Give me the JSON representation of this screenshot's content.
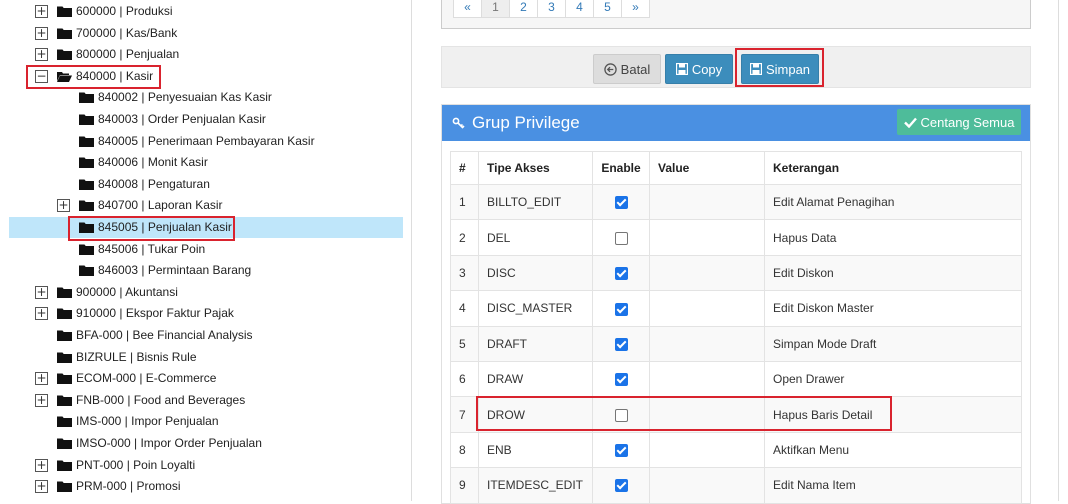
{
  "tree": {
    "nodes": [
      {
        "label": "600000 | Produksi",
        "toggle": "+",
        "open": false
      },
      {
        "label": "700000 | Kas/Bank",
        "toggle": "+",
        "open": false
      },
      {
        "label": "800000 | Penjualan",
        "toggle": "+",
        "open": false
      },
      {
        "label": "840000 | Kasir",
        "toggle": "−",
        "open": true
      },
      {
        "label": "840002 | Penyesuaian Kas Kasir",
        "toggle": "",
        "open": false
      },
      {
        "label": "840003 | Order Penjualan Kasir",
        "toggle": "",
        "open": false
      },
      {
        "label": "840005 | Penerimaan Pembayaran Kasir",
        "toggle": "",
        "open": false
      },
      {
        "label": "840006 | Monit Kasir",
        "toggle": "",
        "open": false
      },
      {
        "label": "840008 | Pengaturan",
        "toggle": "",
        "open": false
      },
      {
        "label": "840700 | Laporan Kasir",
        "toggle": "+",
        "open": false
      },
      {
        "label": "845005 | Penjualan Kasir",
        "toggle": "",
        "open": false,
        "selected": true
      },
      {
        "label": "845006 | Tukar Poin",
        "toggle": "",
        "open": false
      },
      {
        "label": "846003 | Permintaan Barang",
        "toggle": "",
        "open": false
      },
      {
        "label": "900000 | Akuntansi",
        "toggle": "+",
        "open": false
      },
      {
        "label": "910000 | Ekspor Faktur Pajak",
        "toggle": "+",
        "open": false
      },
      {
        "label": "BFA-000 | Bee Financial Analysis",
        "toggle": "",
        "open": false
      },
      {
        "label": "BIZRULE | Bisnis Rule",
        "toggle": "",
        "open": false
      },
      {
        "label": "ECOM-000 | E-Commerce",
        "toggle": "+",
        "open": false
      },
      {
        "label": "FNB-000 | Food and Beverages",
        "toggle": "+",
        "open": false
      },
      {
        "label": "IMS-000 | Impor Penjualan",
        "toggle": "",
        "open": false
      },
      {
        "label": "IMSO-000 | Impor Order Penjualan",
        "toggle": "",
        "open": false
      },
      {
        "label": "PNT-000 | Poin Loyalti",
        "toggle": "+",
        "open": false
      },
      {
        "label": "PRM-000 | Promosi",
        "toggle": "+",
        "open": false
      }
    ]
  },
  "pagination": {
    "prev": "«",
    "pages": [
      "1",
      "2",
      "3",
      "4",
      "5"
    ],
    "active": "1",
    "next": "»"
  },
  "actions": {
    "batal": "Batal",
    "copy": "Copy",
    "simpan": "Simpan"
  },
  "privilege": {
    "title": "Grup Privilege",
    "check_all": "Centang Semua",
    "headers": [
      "#",
      "Tipe Akses",
      "Enable",
      "Value",
      "Keterangan"
    ],
    "rows": [
      {
        "no": "1",
        "tipe": "BILLTO_EDIT",
        "enable": true,
        "value": "",
        "keterangan": "Edit Alamat Penagihan"
      },
      {
        "no": "2",
        "tipe": "DEL",
        "enable": false,
        "value": "",
        "keterangan": "Hapus Data"
      },
      {
        "no": "3",
        "tipe": "DISC",
        "enable": true,
        "value": "",
        "keterangan": "Edit Diskon"
      },
      {
        "no": "4",
        "tipe": "DISC_MASTER",
        "enable": true,
        "value": "",
        "keterangan": "Edit Diskon Master"
      },
      {
        "no": "5",
        "tipe": "DRAFT",
        "enable": true,
        "value": "",
        "keterangan": "Simpan Mode Draft"
      },
      {
        "no": "6",
        "tipe": "DRAW",
        "enable": true,
        "value": "",
        "keterangan": "Open Drawer"
      },
      {
        "no": "7",
        "tipe": "DROW",
        "enable": false,
        "value": "",
        "keterangan": "Hapus Baris Detail"
      },
      {
        "no": "8",
        "tipe": "ENB",
        "enable": true,
        "value": "",
        "keterangan": "Aktifkan Menu"
      },
      {
        "no": "9",
        "tipe": "ITEMDESC_EDIT",
        "enable": true,
        "value": "",
        "keterangan": "Edit Nama Item"
      }
    ]
  },
  "colors": {
    "header_blue": "#4a90e2",
    "button_blue": "#3c8dbc",
    "check_all_green": "#4ebc9a",
    "highlight_red": "#d9232e",
    "selected_row": "#bfe6fa"
  }
}
